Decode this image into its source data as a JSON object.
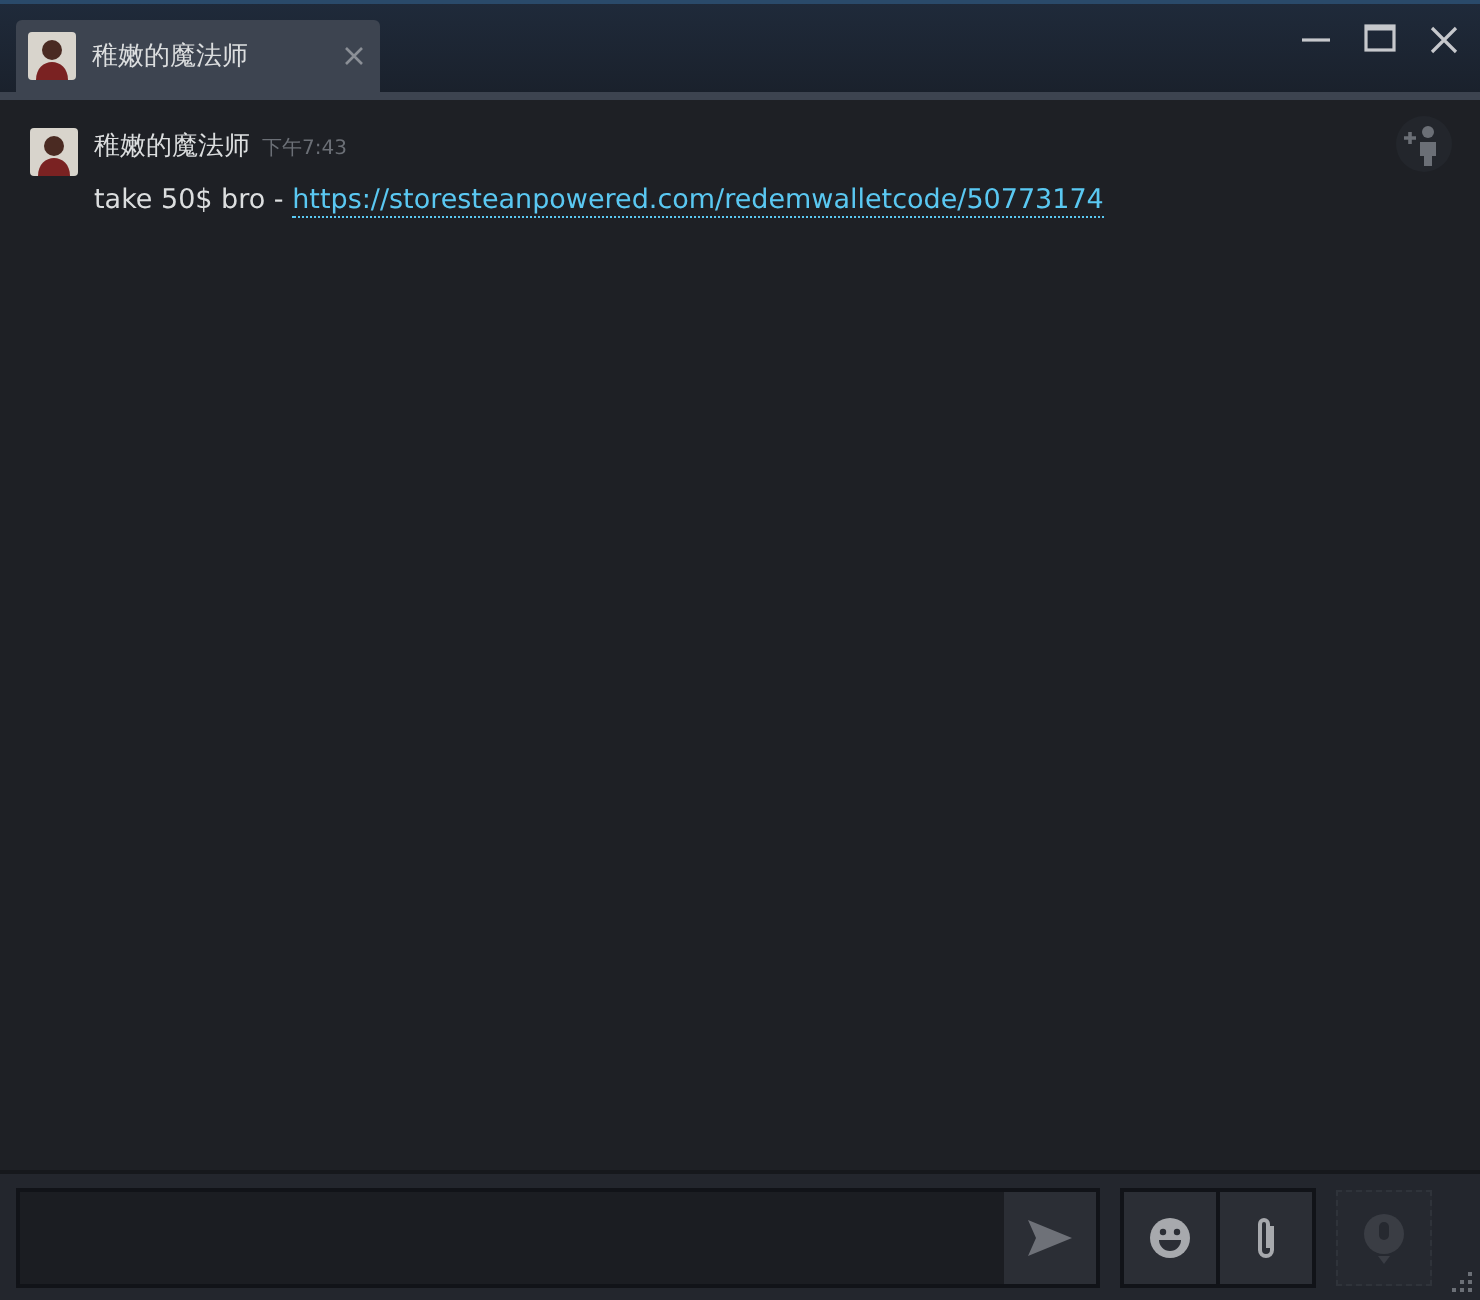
{
  "tab": {
    "title": "稚嫩的魔法师",
    "selected": true
  },
  "messages": [
    {
      "author": "稚嫩的魔法师",
      "time": "下午7:43",
      "text": "take 50$ bro - ",
      "link": "https://storesteanpowered.com/redemwalletcode/50773174"
    }
  ],
  "voice_button": {
    "disabled": true
  }
}
